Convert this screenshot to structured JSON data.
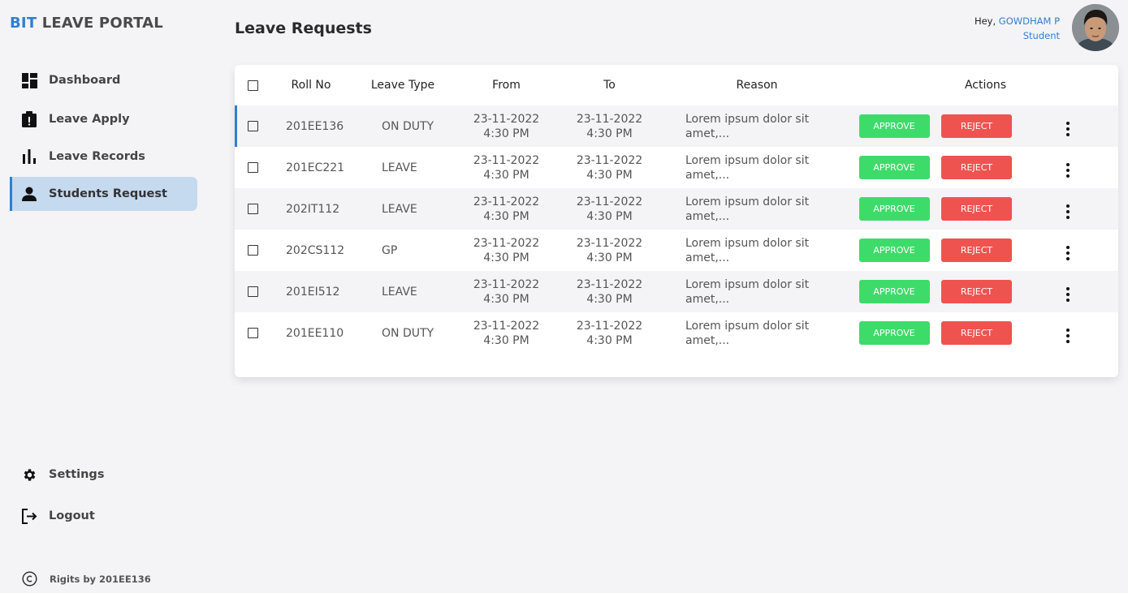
{
  "brand": {
    "part1": "BIT",
    "part2": "LEAVE PORTAL"
  },
  "sidebar": {
    "items": [
      {
        "label": "Dashboard",
        "icon": "dashboard-icon"
      },
      {
        "label": "Leave Apply",
        "icon": "clipboard-alert-icon"
      },
      {
        "label": "Leave Records",
        "icon": "bar-chart-icon"
      },
      {
        "label": "Students Request",
        "icon": "person-icon",
        "active": true
      }
    ],
    "bottom": [
      {
        "label": "Settings",
        "icon": "gear-icon"
      },
      {
        "label": "Logout",
        "icon": "logout-icon"
      }
    ],
    "copyright": "Rigits by 201EE136"
  },
  "page": {
    "title": "Leave Requests"
  },
  "user": {
    "greeting": "Hey,",
    "name": "GOWDHAM P",
    "role": "Student"
  },
  "table": {
    "headers": {
      "roll": "Roll No",
      "type": "Leave Type",
      "from": "From",
      "to": "To",
      "reason": "Reason",
      "actions": "Actions"
    },
    "approve_label": "APPROVE",
    "reject_label": "REJECT",
    "rows": [
      {
        "roll": "201EE136",
        "type": "ON DUTY",
        "from_date": "23-11-2022",
        "from_time": "4:30 PM",
        "to_date": "23-11-2022",
        "to_time": "4:30 PM",
        "reason": "Lorem ipsum dolor sit amet,..."
      },
      {
        "roll": "201EC221",
        "type": "LEAVE",
        "from_date": "23-11-2022",
        "from_time": "4:30 PM",
        "to_date": "23-11-2022",
        "to_time": "4:30 PM",
        "reason": "Lorem ipsum dolor sit amet,..."
      },
      {
        "roll": "202IT112",
        "type": "LEAVE",
        "from_date": "23-11-2022",
        "from_time": "4:30 PM",
        "to_date": "23-11-2022",
        "to_time": "4:30 PM",
        "reason": "Lorem ipsum dolor sit amet,..."
      },
      {
        "roll": "202CS112",
        "type": "GP",
        "from_date": "23-11-2022",
        "from_time": "4:30 PM",
        "to_date": "23-11-2022",
        "to_time": "4:30 PM",
        "reason": "Lorem ipsum dolor sit amet,..."
      },
      {
        "roll": "201EI512",
        "type": "LEAVE",
        "from_date": "23-11-2022",
        "from_time": "4:30 PM",
        "to_date": "23-11-2022",
        "to_time": "4:30 PM",
        "reason": "Lorem ipsum dolor sit amet,..."
      },
      {
        "roll": "201EE110",
        "type": "ON DUTY",
        "from_date": "23-11-2022",
        "from_time": "4:30 PM",
        "to_date": "23-11-2022",
        "to_time": "4:30 PM",
        "reason": "Lorem ipsum dolor sit amet,..."
      }
    ]
  },
  "colors": {
    "accent": "#2f7fd3",
    "active_bg": "#c5d9ef",
    "approve": "#3ddc6a",
    "reject": "#ef5350"
  }
}
